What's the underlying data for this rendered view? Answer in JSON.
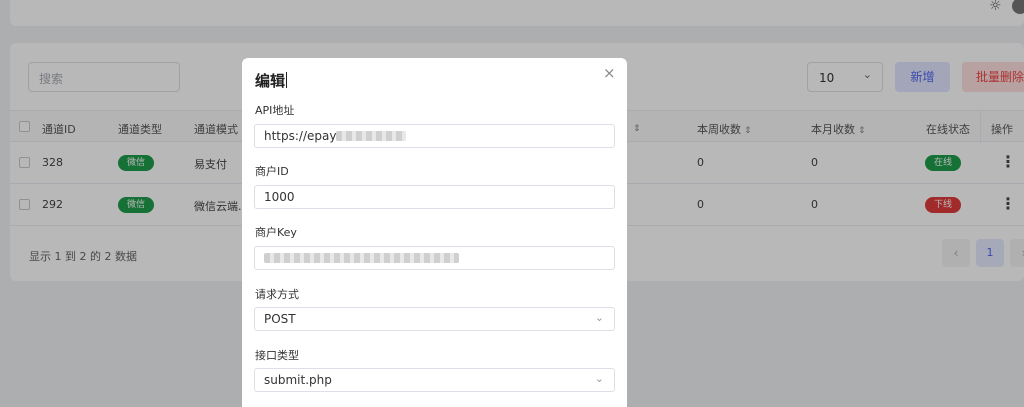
{
  "topbar": {
    "theme_icon": "sun-icon",
    "avatar": "avatar"
  },
  "toolbar": {
    "search_placeholder": "搜索",
    "page_size": "10",
    "add_label": "新增",
    "bulk_delete_label": "批量删除"
  },
  "table": {
    "columns": [
      "通道ID",
      "通道类型",
      "通道模式",
      "本周收数",
      "本月收数",
      "在线状态",
      "操作"
    ],
    "rows": [
      {
        "id": "328",
        "type": "微信",
        "mode": "易支付",
        "week": "0",
        "month": "0",
        "status": "在线",
        "status_color": "#1f9d4b"
      },
      {
        "id": "292",
        "type": "微信",
        "mode": "微信云端...",
        "week": "0",
        "month": "0",
        "status": "下线",
        "status_color": "#e03b3b"
      }
    ]
  },
  "pagination": {
    "summary": "显示 1 到 2 的 2 数据",
    "current_page": "1",
    "prev": "‹",
    "next": "›"
  },
  "modal": {
    "title": "编辑",
    "fields": [
      {
        "label": "API地址",
        "value": "https://epay"
      },
      {
        "label": "商户ID",
        "value": "1000"
      },
      {
        "label": "商户Key",
        "value": ""
      },
      {
        "label": "请求方式",
        "value": "POST"
      },
      {
        "label": "接口类型",
        "value": "submit.php"
      }
    ]
  },
  "colors": {
    "accent": "#4f66f0",
    "danger": "#f04545",
    "success": "#1f9d4b"
  }
}
